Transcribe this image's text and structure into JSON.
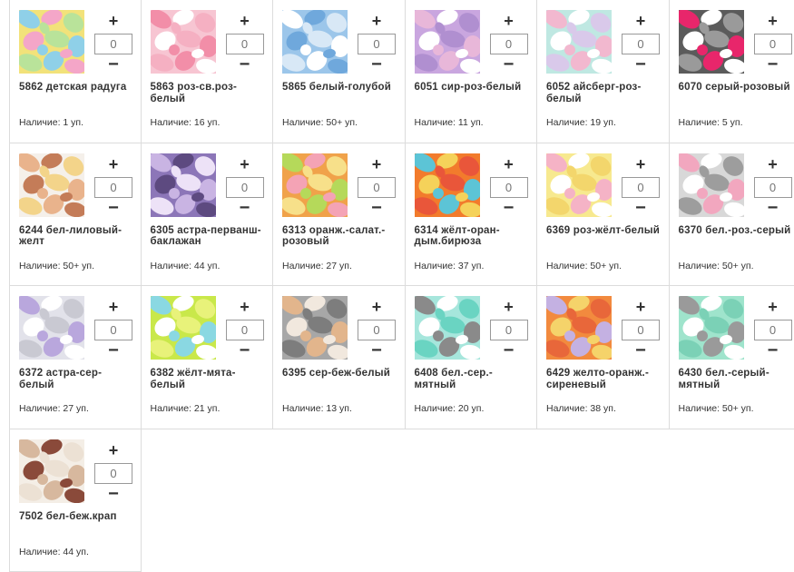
{
  "stock_label": "Наличие:",
  "qty_placeholder": "0",
  "plus_symbol": "+",
  "minus_symbol": "−",
  "products": [
    {
      "name": "5862 детская радуга",
      "stock": "1 уп.",
      "colors": [
        "#f2e27a",
        "#8fd0e8",
        "#f4a6c8",
        "#b9e39a"
      ]
    },
    {
      "name": "5863 роз-св.роз-белый",
      "stock": "16 уп.",
      "colors": [
        "#f7c5d2",
        "#f28ea8",
        "#ffffff",
        "#f5b0c2"
      ]
    },
    {
      "name": "5865 белый-голубой",
      "stock": "50+ уп.",
      "colors": [
        "#9cc6ea",
        "#ffffff",
        "#6fa8dc",
        "#d8e8f6"
      ]
    },
    {
      "name": "6051 сир-роз-белый",
      "stock": "11 уп.",
      "colors": [
        "#c9a6df",
        "#e8b7d9",
        "#ffffff",
        "#b08fd0"
      ]
    },
    {
      "name": "6052 айсберг-роз-белый",
      "stock": "19 уп.",
      "colors": [
        "#bfe8e2",
        "#f2b8cf",
        "#ffffff",
        "#d9c9ea"
      ]
    },
    {
      "name": "6070 серый-розовый",
      "stock": "5 уп.",
      "colors": [
        "#5b5b5b",
        "#e8266b",
        "#ffffff",
        "#9a9a9a"
      ]
    },
    {
      "name": "6244 бел-лиловый-желт",
      "stock": "50+ уп.",
      "colors": [
        "#f5f0ea",
        "#e9b38c",
        "#c47c58",
        "#f3d48a"
      ]
    },
    {
      "name": "6305 астра-перванш-баклажан",
      "stock": "44 уп.",
      "colors": [
        "#8c76b8",
        "#c9b4e3",
        "#5d4a80",
        "#ede2f7"
      ]
    },
    {
      "name": "6313 оранж.-салат.-розовый",
      "stock": "27 уп.",
      "colors": [
        "#f0a24a",
        "#b5d95a",
        "#f4a3b5",
        "#f7e08a"
      ]
    },
    {
      "name": "6314 жёлт-оран-дым.бирюза",
      "stock": "37 уп.",
      "colors": [
        "#f27b2c",
        "#5cc4d6",
        "#f5d25a",
        "#e9563a"
      ]
    },
    {
      "name": "6369 роз-жёлт-белый",
      "stock": "50+ уп.",
      "colors": [
        "#f7e98f",
        "#f5b3c6",
        "#ffffff",
        "#f3d66c"
      ]
    },
    {
      "name": "6370 бел.-роз.-серый",
      "stock": "50+ уп.",
      "colors": [
        "#d8d8d8",
        "#f2a7bf",
        "#ffffff",
        "#9d9d9d"
      ]
    },
    {
      "name": "6372 астра-сер-белый",
      "stock": "27 уп.",
      "colors": [
        "#e2e2ea",
        "#b9a7dd",
        "#ffffff",
        "#c9c9d2"
      ]
    },
    {
      "name": "6382 жёлт-мята-белый",
      "stock": "21 уп.",
      "colors": [
        "#c9e84a",
        "#8ad8e2",
        "#ffffff",
        "#e8f27a"
      ]
    },
    {
      "name": "6395 сер-беж-белый",
      "stock": "13 уп.",
      "colors": [
        "#a7a7a7",
        "#e2b58c",
        "#f1e8de",
        "#7d7d7d"
      ]
    },
    {
      "name": "6408 бел.-сер.-мятный",
      "stock": "20 уп.",
      "colors": [
        "#a6e6dc",
        "#8a8a8a",
        "#ffffff",
        "#6ad4c2"
      ]
    },
    {
      "name": "6429 желто-оранж.-сиреневый",
      "stock": "38 уп.",
      "colors": [
        "#f28a3e",
        "#c4b1e2",
        "#f5d36a",
        "#e8673a"
      ]
    },
    {
      "name": "6430 бел.-серый-мятный",
      "stock": "50+ уп.",
      "colors": [
        "#9fe4cc",
        "#9a9a9a",
        "#ffffff",
        "#7bd1b6"
      ]
    },
    {
      "name": "7502 бел-беж.крап",
      "stock": "44 уп.",
      "colors": [
        "#f4eee6",
        "#d7b89e",
        "#8a4a3a",
        "#ece1d4"
      ]
    }
  ]
}
